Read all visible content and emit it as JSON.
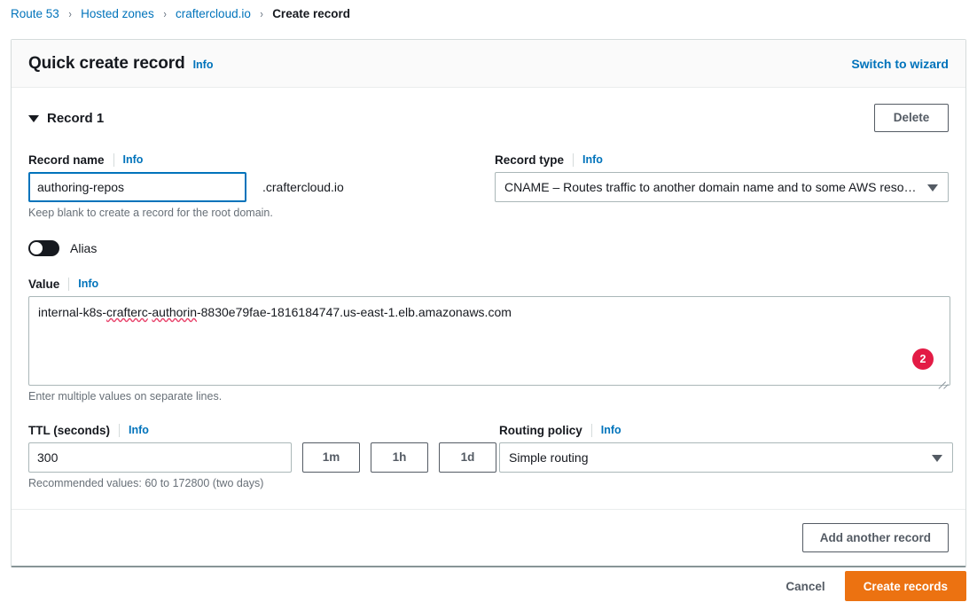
{
  "breadcrumb": {
    "items": [
      {
        "label": "Route 53",
        "current": false
      },
      {
        "label": "Hosted zones",
        "current": false
      },
      {
        "label": "craftercloud.io",
        "current": false
      },
      {
        "label": "Create record",
        "current": true
      }
    ],
    "separator": "›"
  },
  "card": {
    "title": "Quick create record",
    "title_info": "Info",
    "switch_link": "Switch to wizard"
  },
  "record": {
    "section_label": "Record 1",
    "delete_label": "Delete",
    "name": {
      "label": "Record name",
      "info": "Info",
      "value": "authoring-repos",
      "placeholder": "",
      "suffix": ".craftercloud.io",
      "hint": "Keep blank to create a record for the root domain."
    },
    "type": {
      "label": "Record type",
      "info": "Info",
      "selected": "CNAME – Routes traffic to another domain name and to some AWS reso…"
    },
    "alias": {
      "label": "Alias",
      "enabled": false
    },
    "value": {
      "label": "Value",
      "info": "Info",
      "text_before": "internal-k8s-",
      "misspelled_1": "crafterc",
      "text_mid": "-",
      "misspelled_2": "authorin",
      "text_after": "-8830e79fae-1816184747.us-east-1.elb.amazonaws.com",
      "full_text": "internal-k8s-crafterc-authorin-8830e79fae-1816184747.us-east-1.elb.amazonaws.com",
      "hint": "Enter multiple values on separate lines.",
      "badge_count": "2",
      "badge_color": "#e31b45"
    },
    "ttl": {
      "label": "TTL (seconds)",
      "info": "Info",
      "value": "300",
      "hint": "Recommended values: 60 to 172800 (two days)",
      "quick_buttons": [
        "1m",
        "1h",
        "1d"
      ]
    },
    "routing": {
      "label": "Routing policy",
      "info": "Info",
      "selected": "Simple routing"
    },
    "add_another_label": "Add another record"
  },
  "page_actions": {
    "cancel_label": "Cancel",
    "create_label": "Create records",
    "primary_color": "#ec7211"
  }
}
